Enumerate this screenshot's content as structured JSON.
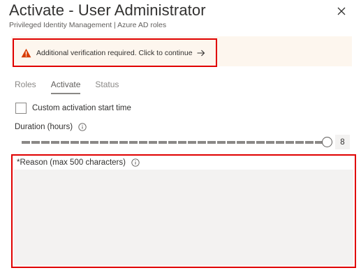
{
  "header": {
    "title": "Activate - User Administrator",
    "subtitle": "Privileged Identity Management | Azure AD roles",
    "close_icon": "close-icon"
  },
  "banner": {
    "text": "Additional verification required. Click to continue",
    "warning_icon": "warning-icon",
    "arrow_icon": "arrow-right-icon",
    "warning_color": "#d83b01"
  },
  "tabs": [
    {
      "label": "Roles",
      "active": false
    },
    {
      "label": "Activate",
      "active": true
    },
    {
      "label": "Status",
      "active": false
    }
  ],
  "form": {
    "custom_start_label": "Custom activation start time",
    "custom_start_checked": false,
    "duration_label": "Duration (hours)",
    "duration_value": "8",
    "reason_label": "*Reason (max 500 characters)",
    "reason_value": ""
  },
  "highlight_color": "#e00000"
}
